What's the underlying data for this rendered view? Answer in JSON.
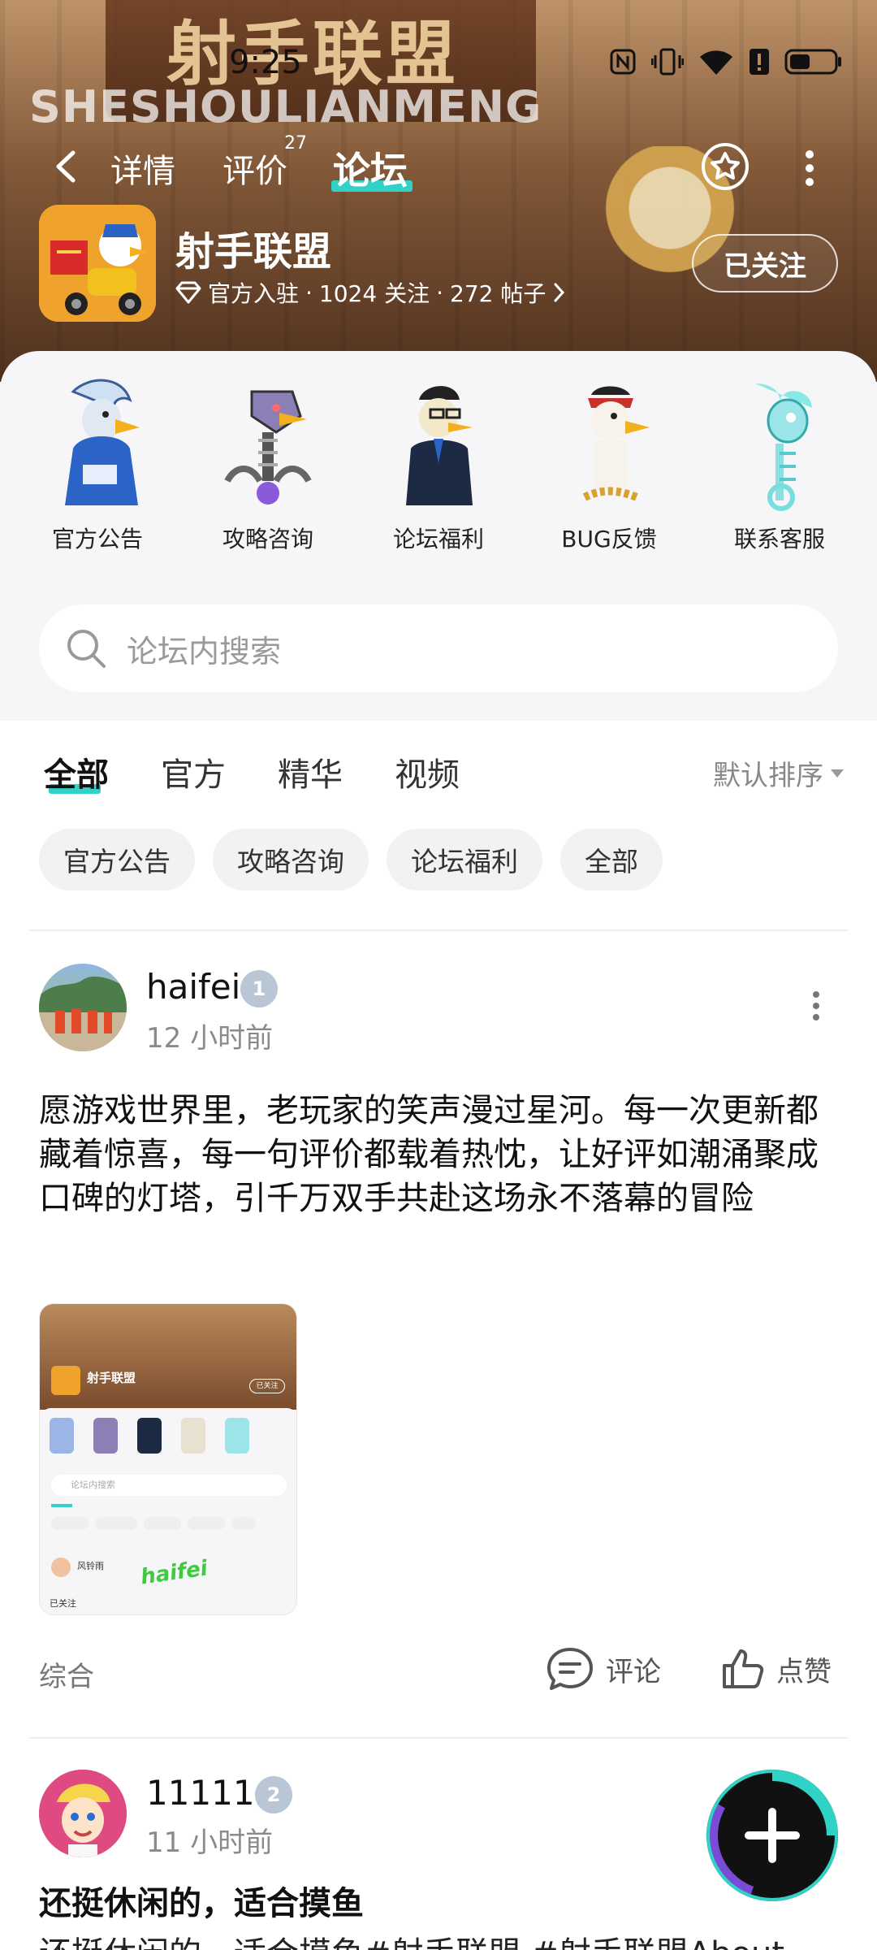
{
  "status_bar": {
    "time": "9:25"
  },
  "header": {
    "sign_text": "射手联盟",
    "watermark": "SHESHOULIANMENG",
    "tabs": [
      {
        "label": "详情"
      },
      {
        "label": "评价",
        "badge": "27"
      },
      {
        "label": "论坛"
      }
    ]
  },
  "forum": {
    "name": "射手联盟",
    "official": "官方入驻",
    "followers": "1024 关注",
    "posts": "272 帖子",
    "follow_label": "已关注"
  },
  "categories": [
    {
      "label": "官方公告"
    },
    {
      "label": "攻略咨询"
    },
    {
      "label": "论坛福利"
    },
    {
      "label": "BUG反馈"
    },
    {
      "label": "联系客服"
    }
  ],
  "search": {
    "placeholder": "论坛内搜索"
  },
  "filter_tabs": [
    {
      "label": "全部"
    },
    {
      "label": "官方"
    },
    {
      "label": "精华"
    },
    {
      "label": "视频"
    }
  ],
  "sort_label": "默认排序",
  "chips": [
    {
      "label": "官方公告"
    },
    {
      "label": "攻略咨询"
    },
    {
      "label": "论坛福利"
    },
    {
      "label": "全部"
    }
  ],
  "posts": [
    {
      "author": "haifei",
      "level": "1",
      "time": "12 小时前",
      "body": "愿游戏世界里，老玩家的笑声漫过星河。每一次更新都藏着惊喜，每一句评价都载着热忱，让好评如潮涌聚成口碑的灯塔，引千万双手共赴这场永不落幕的冒险",
      "tag": "综合",
      "comment_label": "评论",
      "like_label": "点赞",
      "thumb": {
        "title": "射手联盟",
        "follow": "已关注",
        "search": "论坛内搜索",
        "user": "风铃雨",
        "handwriting": "haifei",
        "caption": "已关注"
      }
    },
    {
      "author": "11111",
      "level": "2",
      "time": "11 小时前",
      "title": "还挺休闲的，适合摸鱼",
      "body": "还挺休闲的，适合摸鱼#射手联盟 #射手联盟About"
    }
  ],
  "colors": {
    "accent": "#2fd2c5",
    "header_brown": "#8c5b35"
  }
}
